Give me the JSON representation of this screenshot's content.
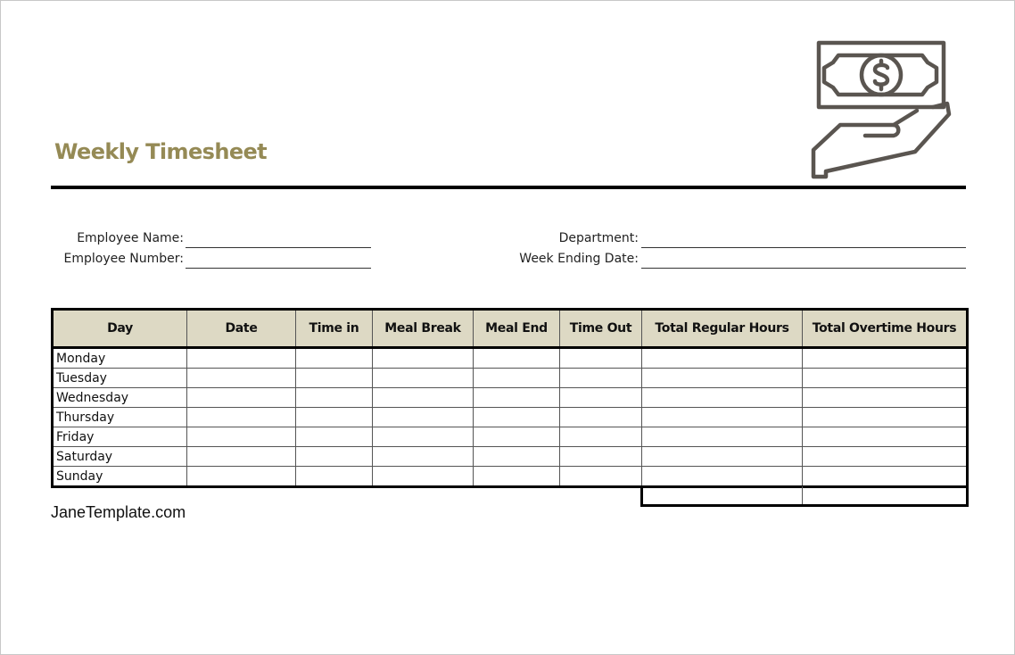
{
  "document": {
    "title": "Weekly Timesheet",
    "icon": "money-in-hand-icon",
    "accent_color": "#958a55",
    "header_fill_color": "#ddd9c4"
  },
  "fields": {
    "employee_name_label": "Employee Name:",
    "employee_name_value": "",
    "employee_number_label": "Employee Number:",
    "employee_number_value": "",
    "department_label": "Department:",
    "department_value": "",
    "week_ending_label": "Week Ending Date:",
    "week_ending_value": ""
  },
  "table": {
    "columns": [
      "Day",
      "Date",
      "Time in",
      "Meal Break",
      "Meal End",
      "Time Out",
      "Total Regular Hours",
      "Total Overtime Hours"
    ],
    "rows": [
      {
        "day": "Monday"
      },
      {
        "day": "Tuesday"
      },
      {
        "day": "Wednesday"
      },
      {
        "day": "Thursday"
      },
      {
        "day": "Friday"
      },
      {
        "day": "Saturday"
      },
      {
        "day": "Sunday"
      }
    ],
    "totals": {
      "regular": "",
      "overtime": ""
    }
  },
  "footer": {
    "site": "JaneTemplate.com"
  }
}
